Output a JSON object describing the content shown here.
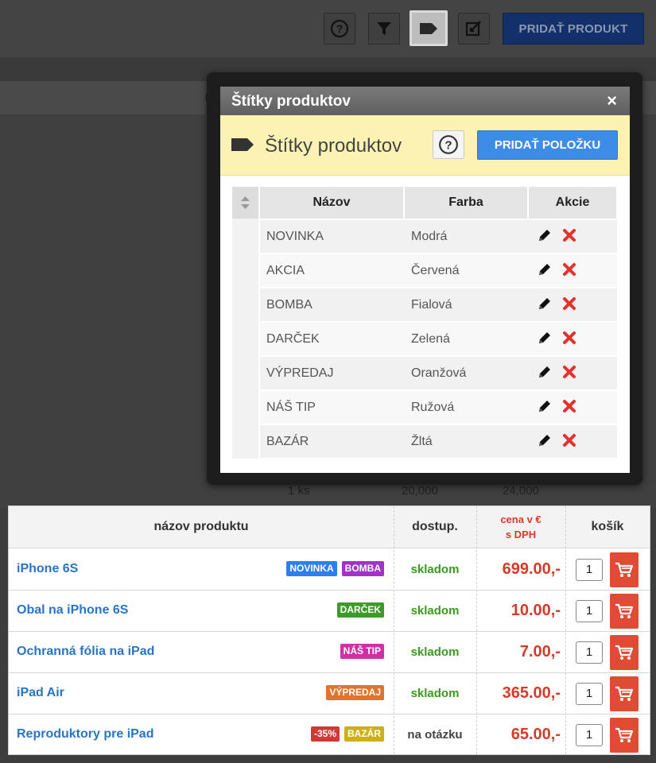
{
  "toolbar": {
    "add_product_label": "PRIDAŤ PRODUKT",
    "icons": [
      "help-circle-icon",
      "filter-icon",
      "tag-icon",
      "edit-square-icon"
    ]
  },
  "background": {
    "column_fragment": "In",
    "row_fragment": {
      "qty": "1 ks",
      "price1": "20,000",
      "price2": "24,000"
    }
  },
  "modal": {
    "title": "Štítky produktov",
    "close_label": "×",
    "header_title": "Štítky produktov",
    "add_item_label": "PRIDAŤ POLOŽKU",
    "columns": {
      "name": "Názov",
      "color": "Farba",
      "actions": "Akcie"
    },
    "rows": [
      {
        "name": "NOVINKA",
        "color": "Modrá"
      },
      {
        "name": "AKCIA",
        "color": "Červená"
      },
      {
        "name": "BOMBA",
        "color": "Fialová"
      },
      {
        "name": "DARČEK",
        "color": "Zelená"
      },
      {
        "name": "VÝPREDAJ",
        "color": "Oranžová"
      },
      {
        "name": "NÁŠ TIP",
        "color": "Ružová"
      },
      {
        "name": "BAZÁR",
        "color": "Žltá"
      }
    ]
  },
  "shop": {
    "headers": {
      "name": "názov produktu",
      "availability": "dostup.",
      "price_line1": "cena v €",
      "price_line2": "s DPH",
      "cart": "košík"
    },
    "products": [
      {
        "name": "iPhone 6S",
        "badges": [
          {
            "text": "NOVINKA",
            "color": "#2d7ff0"
          },
          {
            "text": "BOMBA",
            "color": "#a233c9"
          }
        ],
        "availability": "skladom",
        "availability_color": "#3a9a1e",
        "price": "699.00,-",
        "qty": "1"
      },
      {
        "name": "Obal na iPhone 6S",
        "badges": [
          {
            "text": "DARČEK",
            "color": "#3f9a2c"
          }
        ],
        "availability": "skladom",
        "availability_color": "#3a9a1e",
        "price": "10.00,-",
        "qty": "1"
      },
      {
        "name": "Ochranná fólia na iPad",
        "badges": [
          {
            "text": "NÁŠ TIP",
            "color": "#d12fa8"
          }
        ],
        "availability": "skladom",
        "availability_color": "#3a9a1e",
        "price": "7.00,-",
        "qty": "1"
      },
      {
        "name": "iPad Air",
        "badges": [
          {
            "text": "VÝPREDAJ",
            "color": "#e2732a"
          }
        ],
        "availability": "skladom",
        "availability_color": "#3a9a1e",
        "price": "365.00,-",
        "qty": "1"
      },
      {
        "name": "Reproduktory pre iPad",
        "badges": [
          {
            "text": "-35%",
            "color": "#cf3a36"
          },
          {
            "text": "BAZÁR",
            "color": "#cdb014"
          }
        ],
        "availability": "na otázku",
        "availability_color": "#444444",
        "price": "65.00,-",
        "qty": "1"
      }
    ]
  },
  "colors": {
    "accent_blue": "#3d8de8",
    "price_red": "#d83a2a",
    "cart_red": "#e04b34",
    "link_blue": "#2a74c6"
  }
}
